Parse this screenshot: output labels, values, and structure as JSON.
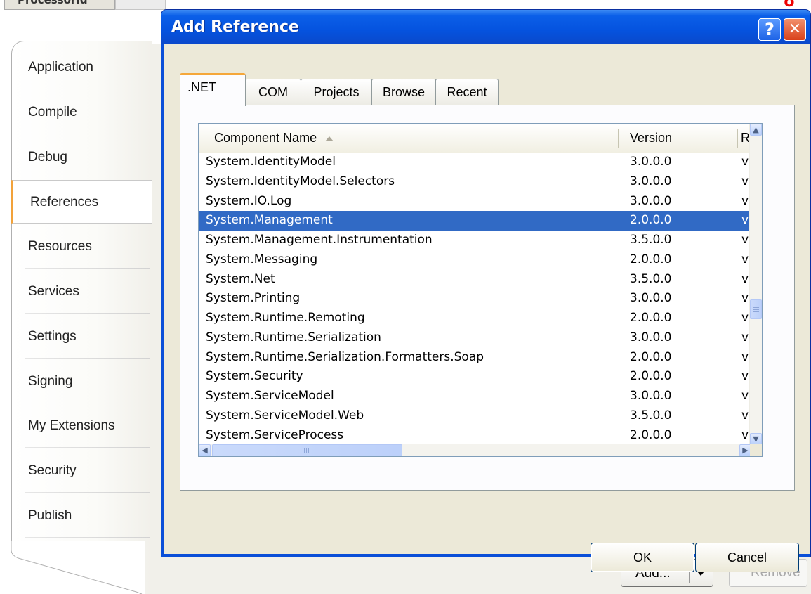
{
  "window": {
    "title": "Add Reference",
    "background_tab": "ProcessorId"
  },
  "title_buttons": {
    "help": "?",
    "close": "✕"
  },
  "sidebar": {
    "items": [
      {
        "label": "Application",
        "selected": false
      },
      {
        "label": "Compile",
        "selected": false
      },
      {
        "label": "Debug",
        "selected": false
      },
      {
        "label": "References",
        "selected": true
      },
      {
        "label": "Resources",
        "selected": false
      },
      {
        "label": "Services",
        "selected": false
      },
      {
        "label": "Settings",
        "selected": false
      },
      {
        "label": "Signing",
        "selected": false
      },
      {
        "label": "My Extensions",
        "selected": false
      },
      {
        "label": "Security",
        "selected": false
      },
      {
        "label": "Publish",
        "selected": false
      }
    ]
  },
  "tabs": [
    {
      "label": ".NET",
      "active": true
    },
    {
      "label": "COM",
      "active": false
    },
    {
      "label": "Projects",
      "active": false
    },
    {
      "label": "Browse",
      "active": false
    },
    {
      "label": "Recent",
      "active": false
    }
  ],
  "list": {
    "columns": [
      "Component Name",
      "Version",
      "R"
    ],
    "rows": [
      {
        "name": "System.IdentityModel",
        "version": "3.0.0.0",
        "runtime": "v",
        "selected": false
      },
      {
        "name": "System.IdentityModel.Selectors",
        "version": "3.0.0.0",
        "runtime": "v",
        "selected": false
      },
      {
        "name": "System.IO.Log",
        "version": "3.0.0.0",
        "runtime": "v",
        "selected": false
      },
      {
        "name": "System.Management",
        "version": "2.0.0.0",
        "runtime": "v",
        "selected": true
      },
      {
        "name": "System.Management.Instrumentation",
        "version": "3.5.0.0",
        "runtime": "v",
        "selected": false
      },
      {
        "name": "System.Messaging",
        "version": "2.0.0.0",
        "runtime": "v",
        "selected": false
      },
      {
        "name": "System.Net",
        "version": "3.5.0.0",
        "runtime": "v",
        "selected": false
      },
      {
        "name": "System.Printing",
        "version": "3.0.0.0",
        "runtime": "v",
        "selected": false
      },
      {
        "name": "System.Runtime.Remoting",
        "version": "2.0.0.0",
        "runtime": "v",
        "selected": false
      },
      {
        "name": "System.Runtime.Serialization",
        "version": "3.0.0.0",
        "runtime": "v",
        "selected": false
      },
      {
        "name": "System.Runtime.Serialization.Formatters.Soap",
        "version": "2.0.0.0",
        "runtime": "v",
        "selected": false
      },
      {
        "name": "System.Security",
        "version": "2.0.0.0",
        "runtime": "v",
        "selected": false
      },
      {
        "name": "System.ServiceModel",
        "version": "3.0.0.0",
        "runtime": "v",
        "selected": false
      },
      {
        "name": "System.ServiceModel.Web",
        "version": "3.5.0.0",
        "runtime": "v",
        "selected": false
      },
      {
        "name": "System.ServiceProcess",
        "version": "2.0.0.0",
        "runtime": "v",
        "selected": false
      }
    ]
  },
  "buttons": {
    "ok": "OK",
    "cancel": "Cancel"
  },
  "page_buttons": {
    "add": "Add...",
    "remove": "Remove"
  },
  "corner_mark": "ʻo",
  "colors": {
    "selection": "#316ac5",
    "titlebar": "#0553df",
    "active_tab_accent": "#f5a73a",
    "dialog_face": "#ece9d8"
  },
  "icons": {
    "scroll_up": "chevron-up-icon",
    "scroll_down": "chevron-down-icon",
    "scroll_left": "chevron-left-icon",
    "scroll_right": "chevron-right-icon",
    "sort": "sort-ascending-icon"
  }
}
